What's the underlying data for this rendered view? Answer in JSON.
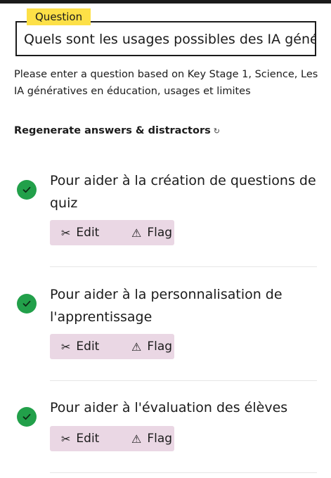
{
  "question": {
    "tag": "Question",
    "value": "Quels sont les usages possibles des IA génératives en éducation ?"
  },
  "hint": "Please enter a question based on Key Stage 1, Science, Les IA génératives en éducation, usages et limites",
  "regenerate": {
    "label": "Regenerate answers & distractors",
    "icon": "↻"
  },
  "answers": [
    {
      "text": "Pour aider à la création de questions de quiz",
      "status": "correct"
    },
    {
      "text": "Pour aider à la personnalisation de l'apprentissage",
      "status": "correct"
    },
    {
      "text": "Pour aider à l'évaluation des élèves",
      "status": "correct"
    }
  ],
  "actions": {
    "edit_label": "Edit",
    "flag_label": "Flag",
    "edit_icon": "✂",
    "flag_icon": "⚠"
  },
  "colors": {
    "tag_bg": "#fde047",
    "check_green": "#22a04a",
    "action_bg": "#ead7e4"
  }
}
